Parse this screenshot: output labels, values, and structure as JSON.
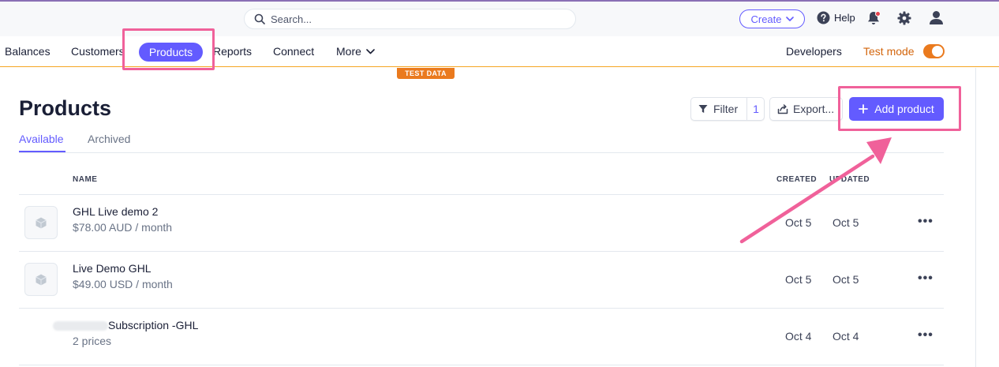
{
  "topbar": {
    "search_placeholder": "Search...",
    "create_label": "Create",
    "help_label": "Help"
  },
  "nav": {
    "items": [
      "Balances",
      "Customers",
      "Products",
      "Reports",
      "Connect",
      "More"
    ],
    "active": "Products",
    "developers_label": "Developers",
    "test_mode_label": "Test mode",
    "test_mode_on": true
  },
  "test_badge": "TEST DATA",
  "page": {
    "title": "Products",
    "tabs": [
      "Available",
      "Archived"
    ],
    "active_tab": "Available",
    "filter_label": "Filter",
    "filter_count": "1",
    "export_label": "Export...",
    "add_label": "Add product"
  },
  "table": {
    "columns": {
      "name": "NAME",
      "created": "CREATED",
      "updated": "UPDATED"
    },
    "rows": [
      {
        "name": "GHL Live demo 2",
        "price": "$78.00 AUD / month",
        "created": "Oct 5",
        "updated": "Oct 5"
      },
      {
        "name": "Live Demo GHL",
        "price": "$49.00 USD / month",
        "created": "Oct 5",
        "updated": "Oct 5"
      },
      {
        "name": "Subscription -GHL",
        "price": "2 prices",
        "created": "Oct 4",
        "updated": "Oct 4"
      }
    ],
    "more_glyph": "•••"
  },
  "colors": {
    "accent": "#635bff",
    "test_orange": "#ea7a1e",
    "highlight_pink": "#f0619a"
  },
  "icons": [
    "search-icon",
    "chevron-down-icon",
    "help-icon",
    "bell-icon",
    "gear-icon",
    "user-icon",
    "filter-icon",
    "export-icon",
    "plus-icon",
    "box-icon",
    "more-horizontal-icon"
  ]
}
